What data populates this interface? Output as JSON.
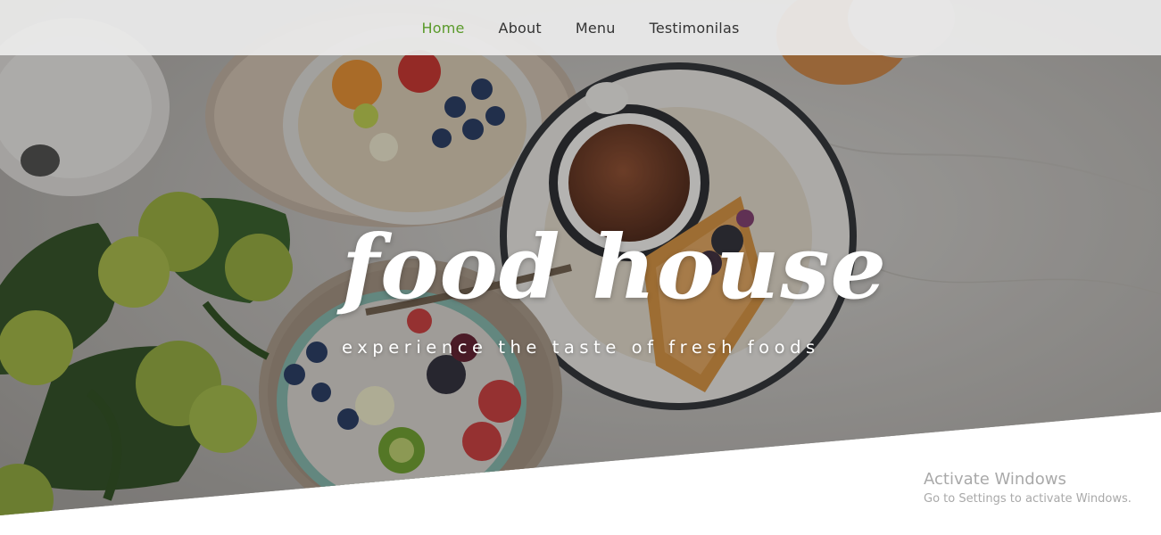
{
  "nav": {
    "items": [
      {
        "label": "Home",
        "active": true
      },
      {
        "label": "About",
        "active": false
      },
      {
        "label": "Menu",
        "active": false
      },
      {
        "label": "Testimonilas",
        "active": false
      }
    ]
  },
  "hero": {
    "title": "food house",
    "tagline": "experience the taste of fresh foods"
  },
  "watermark": {
    "title": "Activate Windows",
    "subtitle": "Go to Settings to activate Windows."
  },
  "colors": {
    "nav_active": "#5a9a2a",
    "nav_text": "#333333",
    "hero_text": "#ffffff"
  }
}
